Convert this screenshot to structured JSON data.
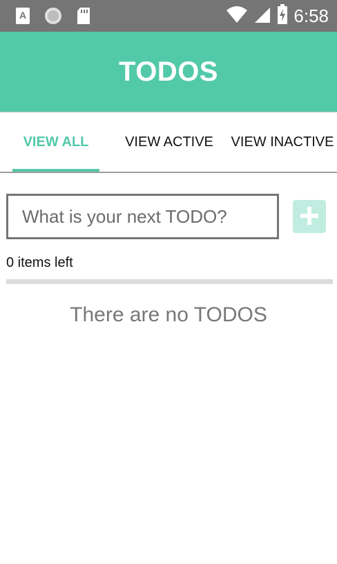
{
  "status_bar": {
    "time": "6:58",
    "icons": [
      "text-a-icon",
      "circle-icon",
      "sd-card-icon",
      "wifi-icon",
      "signal-icon",
      "battery-icon"
    ]
  },
  "app_bar": {
    "title": "TODOS",
    "color": "#52c9a9"
  },
  "tabs": [
    {
      "label": "VIEW ALL",
      "active": true
    },
    {
      "label": "VIEW ACTIVE",
      "active": false
    },
    {
      "label": "VIEW INACTIVE",
      "active": false
    }
  ],
  "new_todo": {
    "placeholder": "What is your next TODO?",
    "value": ""
  },
  "add_button": {
    "icon": "plus-icon",
    "color": "#c1ede0"
  },
  "summary": {
    "items_left": "0 items left"
  },
  "empty_state": {
    "text": "There are no TODOS"
  }
}
